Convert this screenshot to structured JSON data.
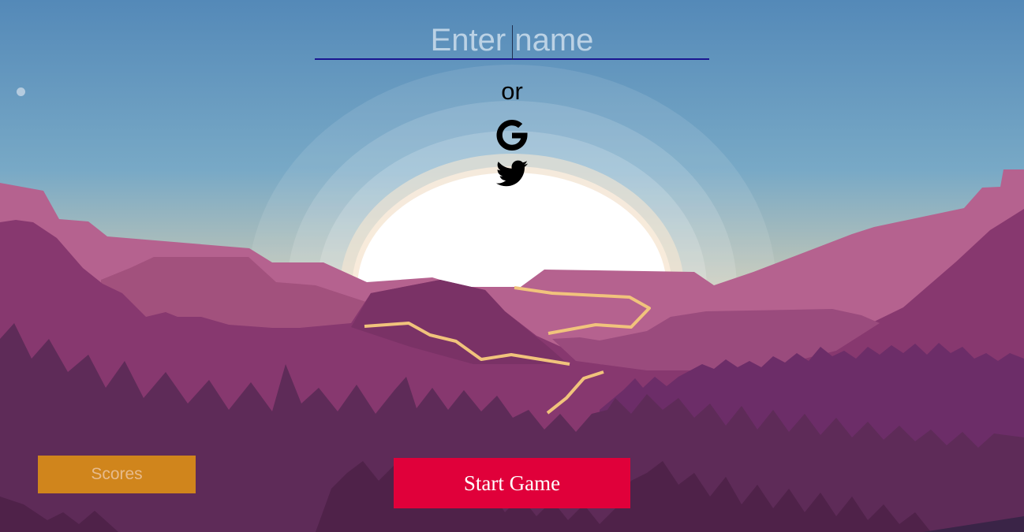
{
  "login": {
    "name_placeholder": "Enter name",
    "name_value": "",
    "or_label": "or",
    "google_icon": "google-icon",
    "twitter_icon": "twitter-icon"
  },
  "buttons": {
    "scores_label": "Scores",
    "start_label": "Start Game"
  },
  "colors": {
    "sky_top": "#5489b8",
    "sky_bottom": "#e8cba0",
    "sun": "#ffffff",
    "mountain_light": "#b5628f",
    "mountain_mid": "#87386f",
    "forest": "#5e2b58",
    "trail": "#f1c37c",
    "input_underline": "#1a1690",
    "scores_button": "#d0851c",
    "start_button": "#e0003a"
  }
}
